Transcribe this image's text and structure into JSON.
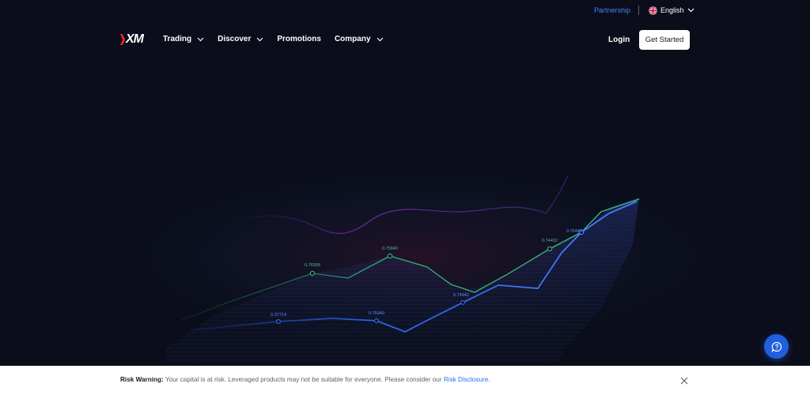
{
  "topbar": {
    "partnership_label": "Partnership",
    "language_label": "English",
    "flag_icon": "uk-flag-icon"
  },
  "nav": {
    "logo_text": "XM",
    "items": [
      {
        "label": "Trading",
        "has_dropdown": true
      },
      {
        "label": "Discover",
        "has_dropdown": true
      },
      {
        "label": "Promotions",
        "has_dropdown": false
      },
      {
        "label": "Company",
        "has_dropdown": true
      }
    ],
    "login_label": "Login",
    "cta_label": "Get Started"
  },
  "hero": {
    "labels": [
      "0.76058",
      "0.75840",
      "0.74492",
      "0.76449",
      "0.37714",
      "0.75040",
      "0.74442"
    ]
  },
  "chat": {
    "icon": "chat-bubble-icon"
  },
  "risk_banner": {
    "title": "Risk Warning:",
    "text": "Your capital is at risk. Leveraged products may not be suitable for everyone. Please consider our",
    "link_label": "Risk Disclosure",
    "end": "."
  },
  "colors": {
    "background": "#0b0e1a",
    "accent_blue": "#2a6ef0",
    "partnership_blue": "#3d86f5",
    "green_line": "#2fa874",
    "purple_line": "#6a2aa8"
  }
}
